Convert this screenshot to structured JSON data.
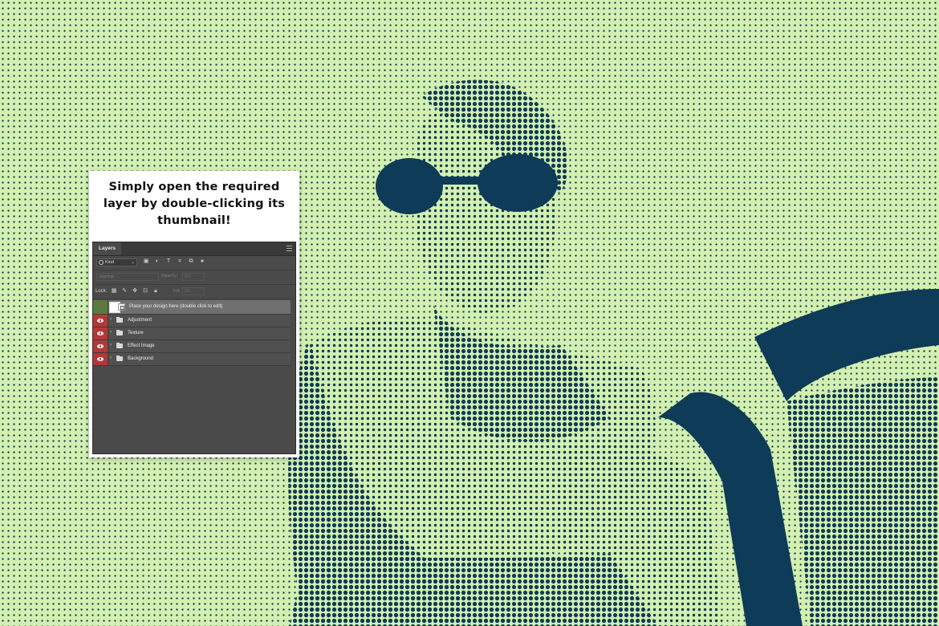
{
  "instruction": {
    "text": "Simply open the required layer by double-clicking its thumbnail!"
  },
  "panel": {
    "tab_label": "Layers",
    "filter": {
      "kind_label": "Kind",
      "icons": [
        "image-filter-icon",
        "adjustment-filter-icon",
        "type-filter-icon",
        "shape-filter-icon",
        "smart-object-filter-icon",
        "toggle-filter-icon"
      ],
      "type_glyph": "T"
    },
    "blend": {
      "mode": "Normal",
      "opacity_label": "Opacity:",
      "opacity_value": "0%"
    },
    "lock": {
      "label": "Lock:",
      "icons": [
        "lock-pixels-icon",
        "lock-image-icon",
        "lock-position-icon",
        "lock-artboard-icon",
        "lock-all-icon"
      ],
      "fill_label": "Fill:",
      "fill_value": "0%"
    },
    "layers": [
      {
        "name": "Place your design here (double click to edit)",
        "type": "smart-object",
        "visible": false,
        "selected": true
      },
      {
        "name": "Adjustment",
        "type": "group",
        "visible": true,
        "selected": false
      },
      {
        "name": "Texture",
        "type": "group",
        "visible": true,
        "selected": false
      },
      {
        "name": "Effect Image",
        "type": "group",
        "visible": true,
        "selected": false
      },
      {
        "name": "Background",
        "type": "group",
        "visible": true,
        "selected": false
      }
    ]
  },
  "colors": {
    "background": "#d4f0b0",
    "halftone": "#0e3b57",
    "eye_visible": "#b33838",
    "eye_hidden": "#5c7a3d"
  }
}
